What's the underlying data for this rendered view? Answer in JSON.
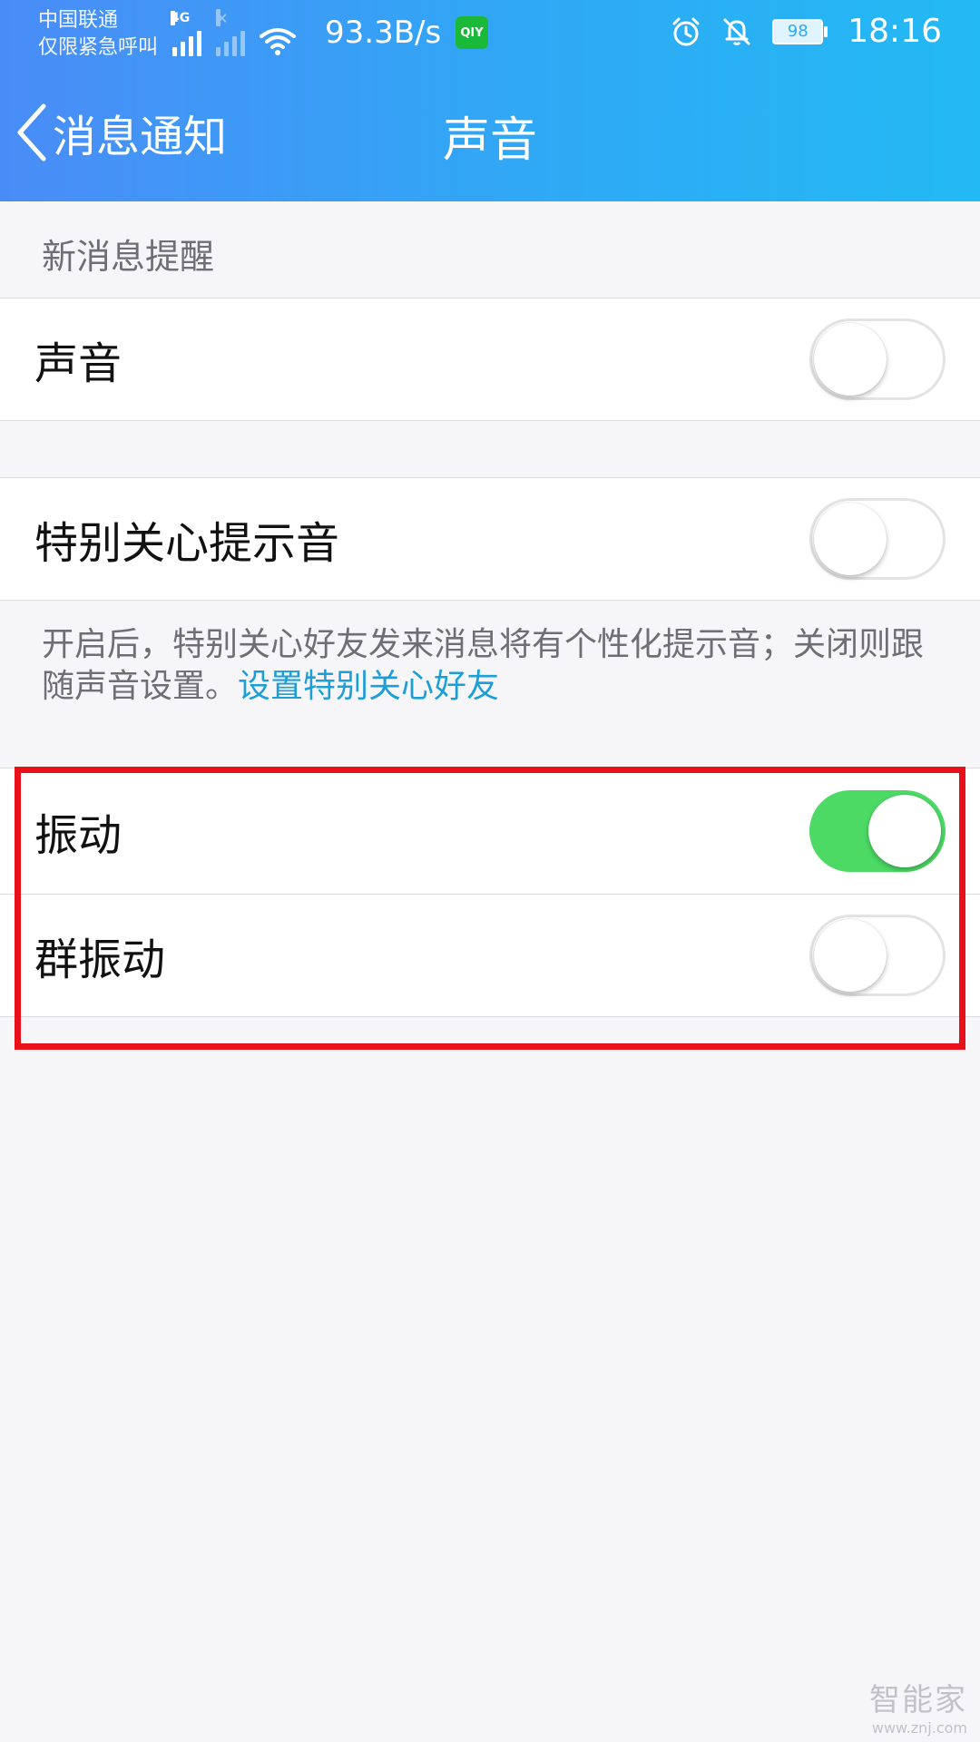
{
  "status_bar": {
    "carrier": "中国联通",
    "emergency": "仅限紧急呼叫",
    "network_tag": "4G",
    "net_speed": "93.3B/s",
    "app_badge": "QIY",
    "battery": "98",
    "time": "18:16"
  },
  "nav": {
    "back_label": "消息通知",
    "title": "声音"
  },
  "section": {
    "label": "新消息提醒"
  },
  "settings": [
    {
      "label": "声音",
      "on": false
    },
    {
      "label": "特别关心提示音",
      "on": false
    },
    {
      "label": "振动",
      "on": true
    },
    {
      "label": "群振动",
      "on": false
    }
  ],
  "description": {
    "text": "开启后，特别关心好友发来消息将有个性化提示音；关闭则跟随声音设置。",
    "link": "设置特别关心好友"
  },
  "watermark": {
    "main": "智能家",
    "sub": "www.znj.com"
  },
  "colors": {
    "header_start": "#4a8cf7",
    "header_end": "#23b9f4",
    "toggle_on": "#4cd964",
    "link": "#1b9fd6",
    "highlight": "#e8101a"
  }
}
